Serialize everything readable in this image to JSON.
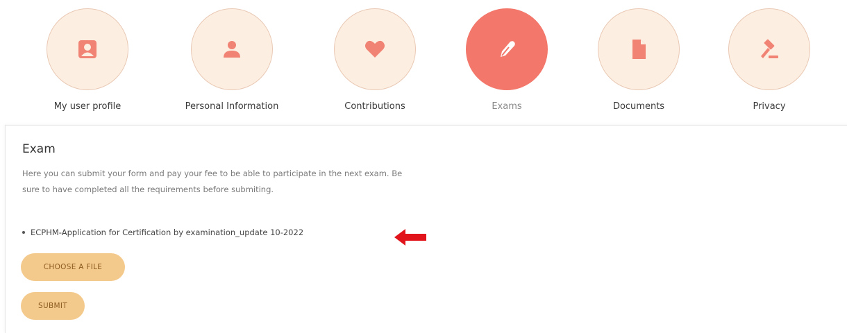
{
  "nav": {
    "items": [
      {
        "label": "My user profile",
        "icon": "id-card-icon"
      },
      {
        "label": "Personal Information",
        "icon": "user-icon"
      },
      {
        "label": "Contributions",
        "icon": "heart-icon"
      },
      {
        "label": "Exams",
        "icon": "pen-icon",
        "active": true
      },
      {
        "label": "Documents",
        "icon": "document-icon"
      },
      {
        "label": "Privacy",
        "icon": "gavel-icon"
      }
    ]
  },
  "exam": {
    "title": "Exam",
    "description": "Here you can submit your form and pay your fee to be able to participate in the next exam. Be sure to have completed all the requirements before submiting.",
    "files": [
      "ECPHM-Application for Certification by examination_update 10-2022"
    ],
    "choose_file_label": "CHOOSE A FILE",
    "submit_label": "SUBMIT"
  },
  "colors": {
    "circle_bg": "#fdeee2",
    "circle_active": "#f3776a",
    "icon": "#f08373",
    "button": "#f4c98c",
    "arrow": "#e0141a"
  }
}
